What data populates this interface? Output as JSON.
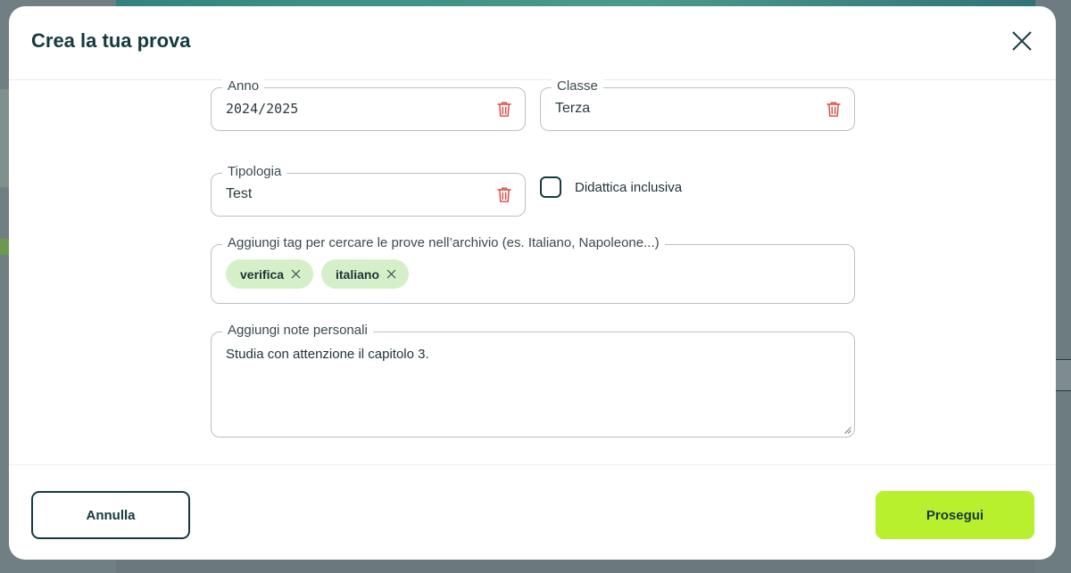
{
  "modal": {
    "title": "Crea la tua prova",
    "close_icon": "close-icon"
  },
  "form": {
    "anno": {
      "label": "Anno",
      "value": "2024/2025"
    },
    "classe": {
      "label": "Classe",
      "value": "Terza"
    },
    "tipologia": {
      "label": "Tipologia",
      "value": "Test"
    },
    "didattica": {
      "label": "Didattica inclusiva",
      "checked": false
    },
    "tags": {
      "label": "Aggiungi tag per cercare le prove nell’archivio (es. Italiano, Napoleone...)",
      "items": [
        "verifica",
        "italiano"
      ]
    },
    "notes": {
      "label": "Aggiungi note personali",
      "value": "Studia con attenzione il capitolo 3."
    }
  },
  "footer": {
    "cancel_label": "Annulla",
    "continue_label": "Prosegui"
  },
  "colors": {
    "accent": "#b8f02e",
    "title": "#143a40",
    "chip": "#d5f0c8",
    "trash": "#e0473f"
  }
}
